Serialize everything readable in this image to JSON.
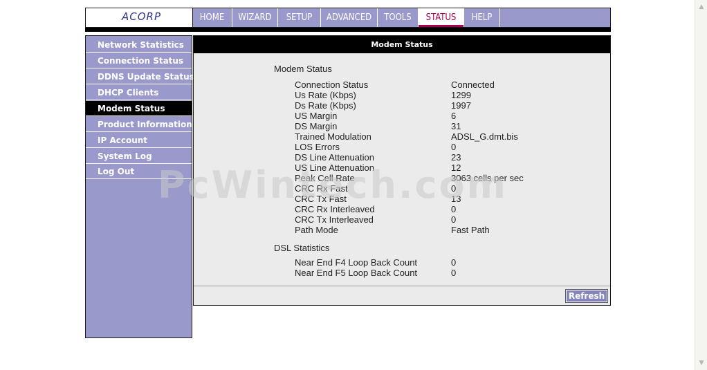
{
  "logo": {
    "text": "ACORP"
  },
  "nav": {
    "tabs": [
      {
        "label": "HOME"
      },
      {
        "label": "WIZARD"
      },
      {
        "label": "SETUP"
      },
      {
        "label": "ADVANCED"
      },
      {
        "label": "TOOLS"
      },
      {
        "label": "STATUS",
        "active": true
      },
      {
        "label": "HELP"
      }
    ]
  },
  "sidebar": {
    "items": [
      {
        "label": "Network Statistics"
      },
      {
        "label": "Connection Status"
      },
      {
        "label": "DDNS Update Status"
      },
      {
        "label": "DHCP Clients"
      },
      {
        "label": "Modem Status",
        "active": true
      },
      {
        "label": "Product Information"
      },
      {
        "label": "IP Account"
      },
      {
        "label": "System Log"
      },
      {
        "label": "Log Out"
      }
    ]
  },
  "main": {
    "title": "Modem Status",
    "section1_title": "Modem Status",
    "rows": [
      {
        "label": "Connection Status",
        "value": "Connected"
      },
      {
        "label": "Us Rate (Kbps)",
        "value": "1299"
      },
      {
        "label": "Ds Rate (Kbps)",
        "value": "1997"
      },
      {
        "label": "US Margin",
        "value": "6"
      },
      {
        "label": "DS Margin",
        "value": "31"
      },
      {
        "label": "Trained Modulation",
        "value": "ADSL_G.dmt.bis"
      },
      {
        "label": "LOS Errors",
        "value": "0"
      },
      {
        "label": "DS Line Attenuation",
        "value": "23"
      },
      {
        "label": "US Line Attenuation",
        "value": "12"
      },
      {
        "label": "Peak Cell Rate",
        "value": "3063 cells per sec"
      },
      {
        "label": "CRC Rx Fast",
        "value": "0"
      },
      {
        "label": "CRC Tx Fast",
        "value": "13"
      },
      {
        "label": "CRC Rx Interleaved",
        "value": "0"
      },
      {
        "label": "CRC Tx Interleaved",
        "value": "0"
      },
      {
        "label": "Path Mode",
        "value": "Fast Path"
      }
    ],
    "section2_title": "DSL Statistics",
    "dsl_rows": [
      {
        "label": "Near End F4 Loop Back Count",
        "value": "0"
      },
      {
        "label": "Near End F5 Loop Back Count",
        "value": "0"
      }
    ],
    "refresh_label": "Refresh"
  },
  "watermark": "PcWintech.com",
  "colors": {
    "nav_bg": "#9999cc",
    "active_tab": "#a8004f",
    "sidebar_active": "#000000",
    "panel_bg": "#ebebeb"
  }
}
